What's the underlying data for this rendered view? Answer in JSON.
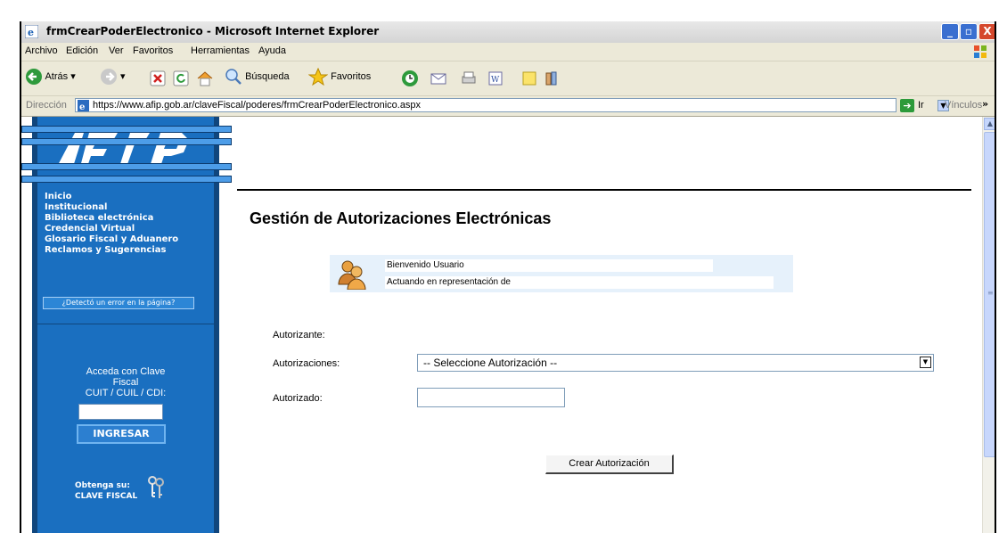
{
  "window": {
    "title": "frmCrearPoderElectronico - Microsoft Internet Explorer",
    "min": "_",
    "max": "▫",
    "close": "X"
  },
  "menu": [
    "Archivo",
    "Edición",
    "Ver",
    "Favoritos",
    "Herramientas",
    "Ayuda"
  ],
  "toolbar": {
    "back": "Atrás",
    "search": "Búsqueda",
    "favorites": "Favoritos"
  },
  "address": {
    "label": "Dirección",
    "url": "https://www.afip.gob.ar/claveFiscal/poderes/frmCrearPoderElectronico.aspx",
    "go": "Ir",
    "links": "Vínculos"
  },
  "sidebar": {
    "nav": [
      "Inicio",
      "Institucional",
      "Biblioteca electrónica",
      "Credencial Virtual",
      "Glosario Fiscal y Aduanero",
      "Reclamos y Sugerencias"
    ],
    "error_button": "¿Detectó un error en la página?",
    "login_line1": "Acceda con Clave",
    "login_line2": "Fiscal",
    "login_line3": "CUIT / CUIL / CDI:",
    "login_button": "INGRESAR",
    "obtenga1": "Obtenga su:",
    "obtenga2": "CLAVE FISCAL"
  },
  "main": {
    "heading": "Gestión de Autorizaciones Electrónicas",
    "welcome": "Bienvenido Usuario",
    "acting": "Actuando en representación de",
    "autorizante_label": "Autorizante:",
    "autorizaciones_label": "Autorizaciones:",
    "select_value": "-- Seleccione Autorización --",
    "autorizado_label": "Autorizado:",
    "submit": "Crear Autorización"
  },
  "colors": {
    "sidebar_blue": "#1a6fc0",
    "welcome_bg": "#e6f1fb"
  }
}
